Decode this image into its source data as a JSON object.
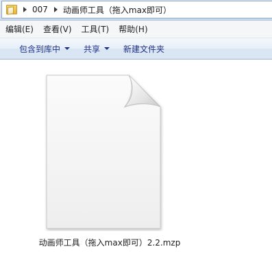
{
  "address_bar": {
    "icon": "folder-icon",
    "crumbs": [
      "007",
      "动画师工具（拖入max即可）"
    ]
  },
  "menu": {
    "items": [
      "编辑(E)",
      "查看(V)",
      "工具(T)",
      "帮助(H)"
    ]
  },
  "commands": {
    "include_in_library": "包含到库中",
    "share": "共享",
    "new_folder": "新建文件夹"
  },
  "files": [
    {
      "name": "动画师工具（拖入max即可）2.2.mzp",
      "icon": "generic-document-icon"
    }
  ]
}
